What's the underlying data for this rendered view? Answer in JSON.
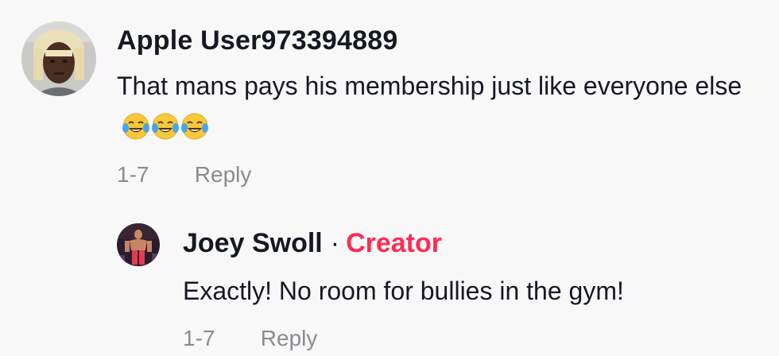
{
  "comment": {
    "username": "Apple User973394889",
    "text": "That mans pays his membership just like everyone else",
    "emoji": [
      "face-with-tears-of-joy",
      "face-with-tears-of-joy",
      "face-with-tears-of-joy"
    ],
    "date": "1-7",
    "reply_label": "Reply"
  },
  "reply": {
    "username": "Joey Swoll",
    "separator": "·",
    "badge": "Creator",
    "text": "Exactly! No room for bullies in the gym!",
    "date": "1-7",
    "reply_label": "Reply"
  },
  "colors": {
    "creator_badge": "#fe2c55",
    "text": "#161823",
    "meta": "#8a8b91",
    "background": "#f8f8f8"
  }
}
